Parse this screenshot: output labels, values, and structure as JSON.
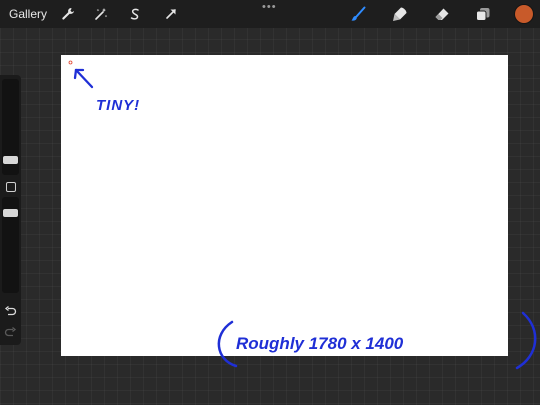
{
  "topbar": {
    "gallery_label": "Gallery",
    "left_tools": [
      "wrench-icon",
      "magic-wand-icon",
      "selection-icon",
      "transform-arrow-icon"
    ],
    "right_tools": [
      "brush-icon",
      "smudge-icon",
      "eraser-icon",
      "layers-icon"
    ],
    "active_tool": "brush-icon",
    "more_label": "•••",
    "color": "#c85a2a"
  },
  "sidebar": {
    "undo_icon": "undo-icon",
    "redo_icon": "redo-icon"
  },
  "canvas": {
    "background": "#ffffff"
  },
  "annotations": {
    "tiny": "TINY!",
    "roughly": "(Roughly 1780 x 1400)",
    "ink_color": "#1f2fd6"
  }
}
